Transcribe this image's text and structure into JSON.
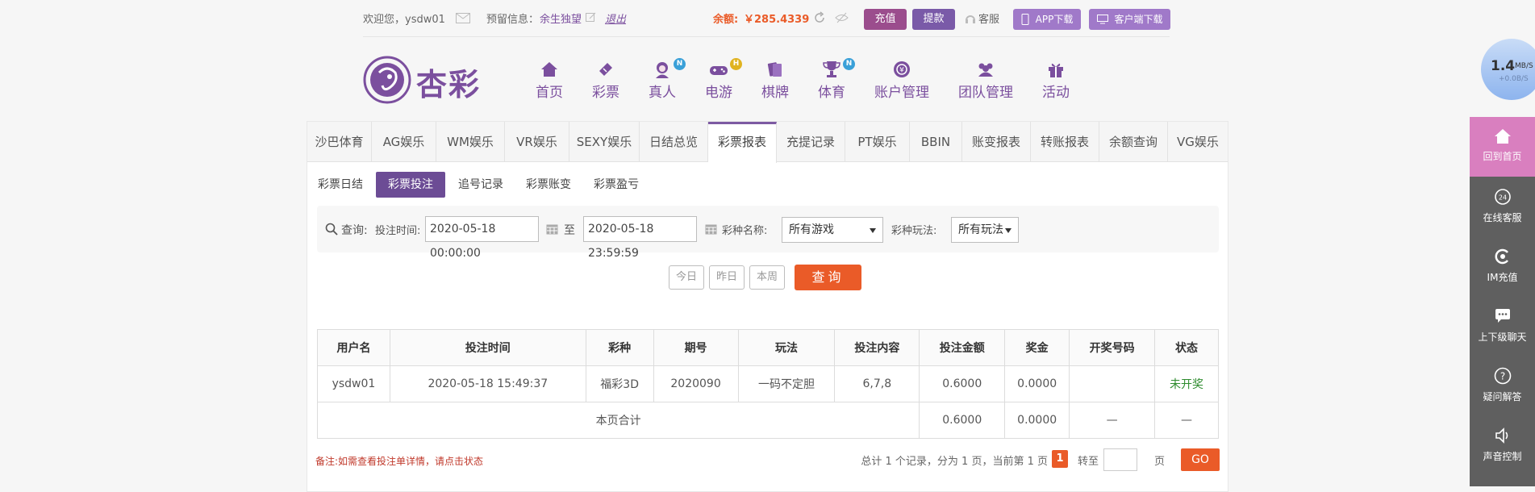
{
  "topbar": {
    "welcome": "欢迎您，ysdw01",
    "reserved_label": "预留信息：",
    "reserved_value": "余生独望",
    "logout": "退出",
    "balance_label": "余额:",
    "balance_value": "￥285.4339",
    "recharge": "充值",
    "withdraw": "提款",
    "service": "客服",
    "app_download": "APP下载",
    "client_download": "客户端下载"
  },
  "logo_text": "杏彩",
  "nav": [
    {
      "label": "首页",
      "icon": "home-icon",
      "badge": ""
    },
    {
      "label": "彩票",
      "icon": "ticket-icon",
      "badge": ""
    },
    {
      "label": "真人",
      "icon": "dealer-icon",
      "badge": "N"
    },
    {
      "label": "电游",
      "icon": "gamepad-icon",
      "badge": "H"
    },
    {
      "label": "棋牌",
      "icon": "cards-icon",
      "badge": ""
    },
    {
      "label": "体育",
      "icon": "trophy-icon",
      "badge": "N"
    },
    {
      "label": "账户管理",
      "icon": "account-icon",
      "badge": ""
    },
    {
      "label": "团队管理",
      "icon": "team-icon",
      "badge": ""
    },
    {
      "label": "活动",
      "icon": "gift-icon",
      "badge": ""
    }
  ],
  "tabs": [
    "沙巴体育",
    "AG娱乐",
    "WM娱乐",
    "VR娱乐",
    "SEXY娱乐",
    "日结总览",
    "彩票报表",
    "充提记录",
    "PT娱乐",
    "BBIN",
    "账变报表",
    "转账报表",
    "余额查询",
    "VG娱乐"
  ],
  "active_tab": "彩票报表",
  "subtabs": [
    "彩票日结",
    "彩票投注",
    "追号记录",
    "彩票账变",
    "彩票盈亏"
  ],
  "active_subtab": "彩票投注",
  "query": {
    "search_label": "查询:",
    "time_label": "投注时间:",
    "start_time": "2020-05-18 00:00:00",
    "to_label": "至",
    "end_time": "2020-05-18 23:59:59",
    "lottery_label": "彩种名称:",
    "lottery_value": "所有游戏",
    "play_label": "彩种玩法:",
    "play_value": "所有玩法",
    "today": "今日",
    "yesterday": "昨日",
    "this_week": "本周",
    "search": "查询"
  },
  "table": {
    "headers": [
      "用户名",
      "投注时间",
      "彩种",
      "期号",
      "玩法",
      "投注内容",
      "投注金额",
      "奖金",
      "开奖号码",
      "状态"
    ],
    "rows": [
      [
        "ysdw01",
        "2020-05-18 15:49:37",
        "福彩3D",
        "2020090",
        "一码不定胆",
        "6,7,8",
        "0.6000",
        "0.0000",
        "",
        "未开奖"
      ]
    ],
    "total_label": "本页合计",
    "total_amount": "0.6000",
    "total_bonus": "0.0000",
    "total_dash1": "—",
    "total_dash2": "—"
  },
  "note": "备注:如需查看投注单详情，请点击状态",
  "pager": {
    "summary": "总计 1 个记录，分为 1 页，当前第 1 页",
    "current": "1",
    "goto_label": "转至",
    "page_unit": "页",
    "go": "GO"
  },
  "speed": {
    "value": "1.4",
    "unit": "MB/S",
    "sub": "+0.0B/S"
  },
  "sidebar": [
    "回到首页",
    "在线客服",
    "IM充值",
    "上下级聊天",
    "疑问解答",
    "声音控制"
  ],
  "colors": {
    "accent": "#7d5aa3",
    "orange": "#ea5b28",
    "sidebar": "#5f5f5f",
    "sidebar_active": "#d97fbf"
  }
}
